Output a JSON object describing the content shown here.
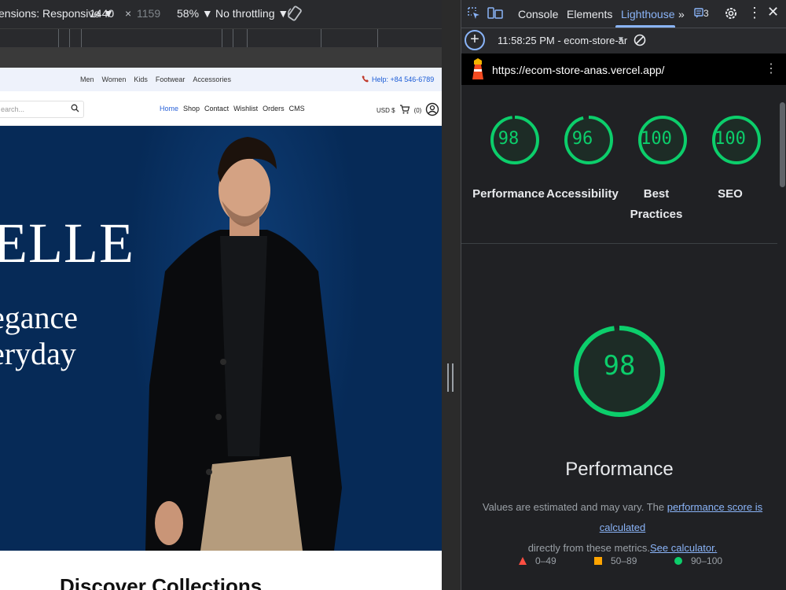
{
  "device_toolbar": {
    "dimensions_label": "ensions: Responsive ▼",
    "width": "1440",
    "times": "×",
    "height": "1159",
    "zoom": "58% ▼",
    "throttling": "No throttling ▼"
  },
  "store": {
    "categories": [
      "Men",
      "Women",
      "Kids",
      "Footwear",
      "Accessories"
    ],
    "help": "Help: +84 546-6789",
    "search_placeholder": "earch...",
    "nav": [
      "Home",
      "Shop",
      "Contact",
      "Wishlist",
      "Orders",
      "CMS"
    ],
    "currency": "USD $",
    "cart_count": "(0)",
    "hero_brand": "CELLE",
    "hero_tagline_1": "egance",
    "hero_tagline_2": "eryday",
    "section_title": "Discover Collections"
  },
  "devtools": {
    "tabs": [
      "Console",
      "Elements",
      "Lighthouse"
    ],
    "active_tab": "Lighthouse",
    "more_tabs": "»",
    "issues_count": "3",
    "run_label": "11:58:25 PM - ecom-store-ar",
    "url": "https://ecom-store-anas.vercel.app/"
  },
  "lighthouse": {
    "scores": [
      {
        "value": 98,
        "display": "98",
        "label": "Performance"
      },
      {
        "value": 96,
        "display": "96",
        "label": "Accessibility"
      },
      {
        "value": 100,
        "display": "100",
        "label": "Best Practices"
      },
      {
        "value": 100,
        "display": "100",
        "label": "SEO"
      }
    ],
    "main_score": "98",
    "main_label": "Performance",
    "desc_pre": "Values are estimated and may vary. The ",
    "desc_link1": "performance score is calculated",
    "desc_mid": " directly from these metrics.",
    "desc_link2": "See calculator.",
    "legend": [
      "0–49",
      "50–89",
      "90–100"
    ]
  },
  "colors": {
    "pass": "#0cce6b",
    "average": "#ffa400",
    "fail": "#ff4e42",
    "accent": "#8ab4f8",
    "hero_bg": "#062a57"
  }
}
